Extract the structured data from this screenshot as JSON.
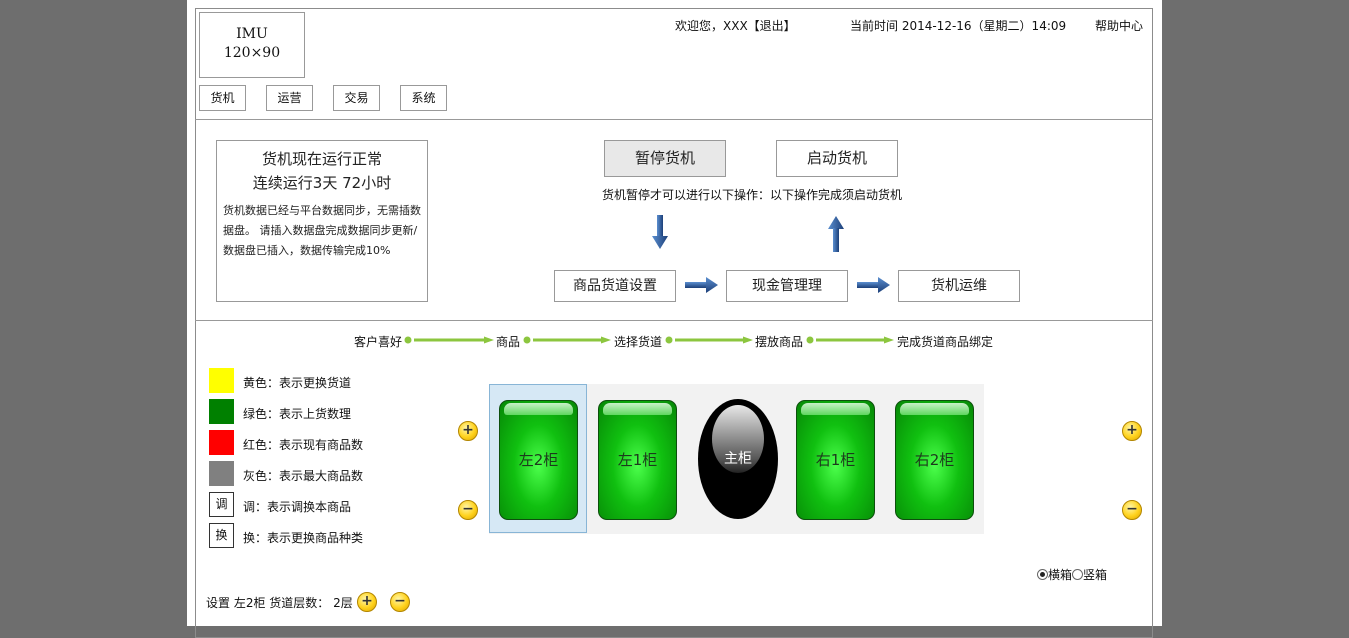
{
  "header": {
    "logo_line1": "IMU",
    "logo_line2": "120×90",
    "welcome": "欢迎您，XXX【退出】",
    "time_label": "当前时间 2014-12-16（星期二）14:09",
    "help": "帮助中心"
  },
  "nav": [
    "货机",
    "运营",
    "交易",
    "系统"
  ],
  "status": {
    "line1": "货机现在运行正常",
    "line2": "连续运行3天 72小时",
    "detail": "货机数据已经与平台数据同步，无需插数据盘。 请插入数据盘完成数据同步更新/数据盘已插入，数据传输完成10%"
  },
  "controls": {
    "pause": "暂停货机",
    "start": "启动货机",
    "hint": "货机暂停才可以进行以下操作：以下操作完成须启动货机"
  },
  "steps": [
    "商品货道设置",
    "现金管理理",
    "货机运维"
  ],
  "flow": [
    "客户喜好",
    "商品",
    "选择货道",
    "摆放商品",
    "完成货道商品绑定"
  ],
  "legend": {
    "items": [
      {
        "color": "#ffff00",
        "text": "黄色：表示更换货道"
      },
      {
        "color": "#008000",
        "text": "绿色：表示上货数理"
      },
      {
        "color": "#ff0000",
        "text": "红色：表示现有商品数"
      },
      {
        "color": "#808080",
        "text": "灰色：表示最大商品数"
      }
    ],
    "box_items": [
      {
        "mark": "调",
        "text": "调：表示调换本商品"
      },
      {
        "mark": "换",
        "text": "换：表示更换商品种类"
      }
    ]
  },
  "cabinets": {
    "left2": "左2柜",
    "left1": "左1柜",
    "main": "主柜",
    "right1": "右1柜",
    "right2": "右2柜"
  },
  "buttons": {
    "plus": "+",
    "minus": "−"
  },
  "orientation": {
    "horizontal": "横箱",
    "vertical": "竖箱",
    "selected": "横箱"
  },
  "bottom": {
    "label": "设置 左2柜 货道层数：  2层"
  }
}
